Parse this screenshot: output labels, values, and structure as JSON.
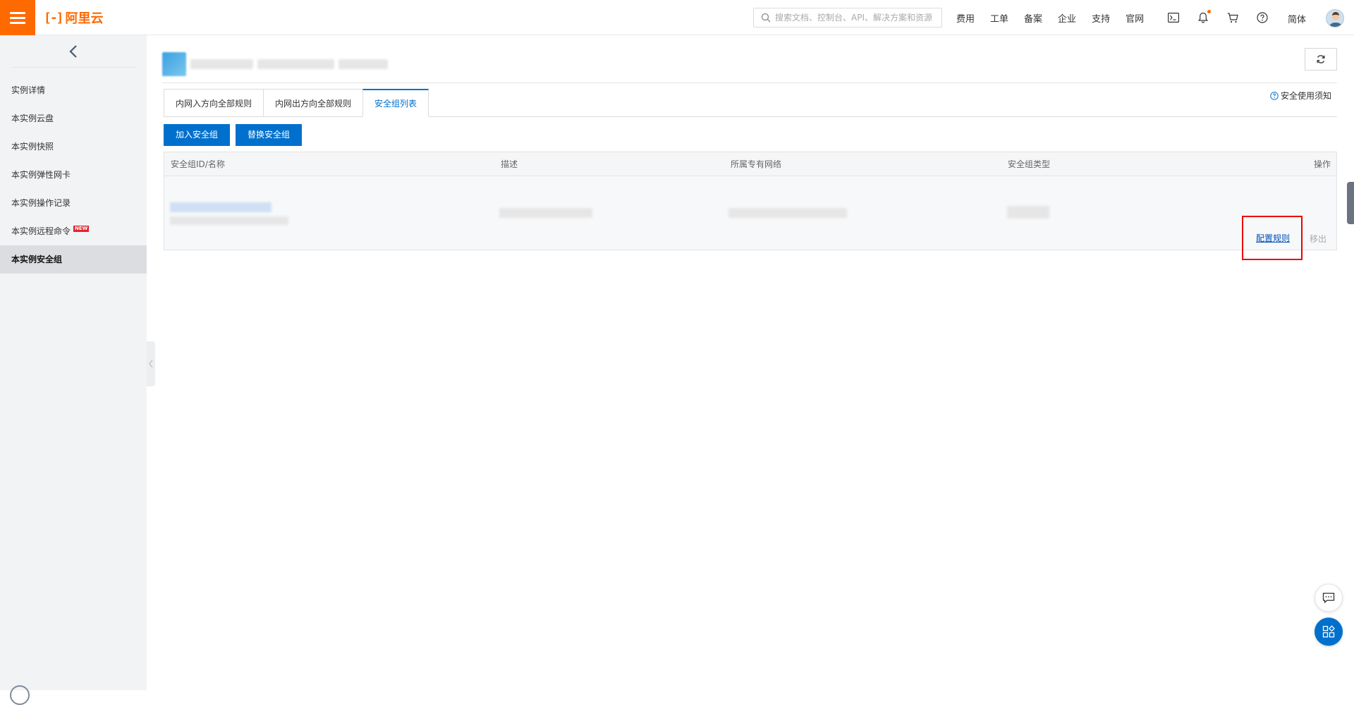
{
  "brand": {
    "name": "阿里云",
    "accent": "#ff6a00",
    "primary": "#0070cc"
  },
  "search": {
    "placeholder": "搜索文档、控制台、API、解决方案和资源"
  },
  "top_nav": [
    "费用",
    "工单",
    "备案",
    "企业",
    "支持",
    "官网"
  ],
  "top_icons": [
    "terminal-icon",
    "bell-icon",
    "cart-icon",
    "help-icon"
  ],
  "language": "简体",
  "sidebar": {
    "items": [
      {
        "label": "实例详情"
      },
      {
        "label": "本实例云盘"
      },
      {
        "label": "本实例快照"
      },
      {
        "label": "本实例弹性网卡"
      },
      {
        "label": "本实例操作记录"
      },
      {
        "label": "本实例远程命令",
        "badge": "NEW"
      },
      {
        "label": "本实例安全组",
        "active": true
      }
    ]
  },
  "tabs": [
    {
      "label": "内网入方向全部规则"
    },
    {
      "label": "内网出方向全部规则"
    },
    {
      "label": "安全组列表",
      "active": true
    }
  ],
  "help_link": "安全使用须知",
  "buttons": {
    "join": "加入安全组",
    "replace": "替换安全组"
  },
  "table": {
    "headers": {
      "id_name": "安全组ID/名称",
      "desc": "描述",
      "vpc": "所属专有网络",
      "type": "安全组类型",
      "ops": "操作"
    },
    "row": {
      "action_config": "配置规则",
      "action_remove": "移出"
    }
  }
}
